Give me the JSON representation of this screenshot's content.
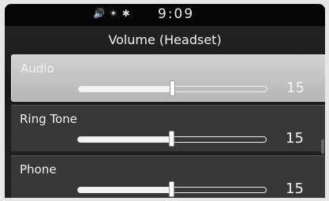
{
  "status": {
    "icons": [
      "speaker-icon",
      "signal-icon",
      "bluetooth-icon"
    ],
    "time": "9:09"
  },
  "title": "Volume (Headset)",
  "rows": [
    {
      "label": "Audio",
      "value": "15",
      "level": 0.5,
      "selected": true
    },
    {
      "label": "Ring Tone",
      "value": "15",
      "level": 0.5,
      "selected": false
    },
    {
      "label": "Phone",
      "value": "15",
      "level": 0.5,
      "selected": false
    }
  ]
}
